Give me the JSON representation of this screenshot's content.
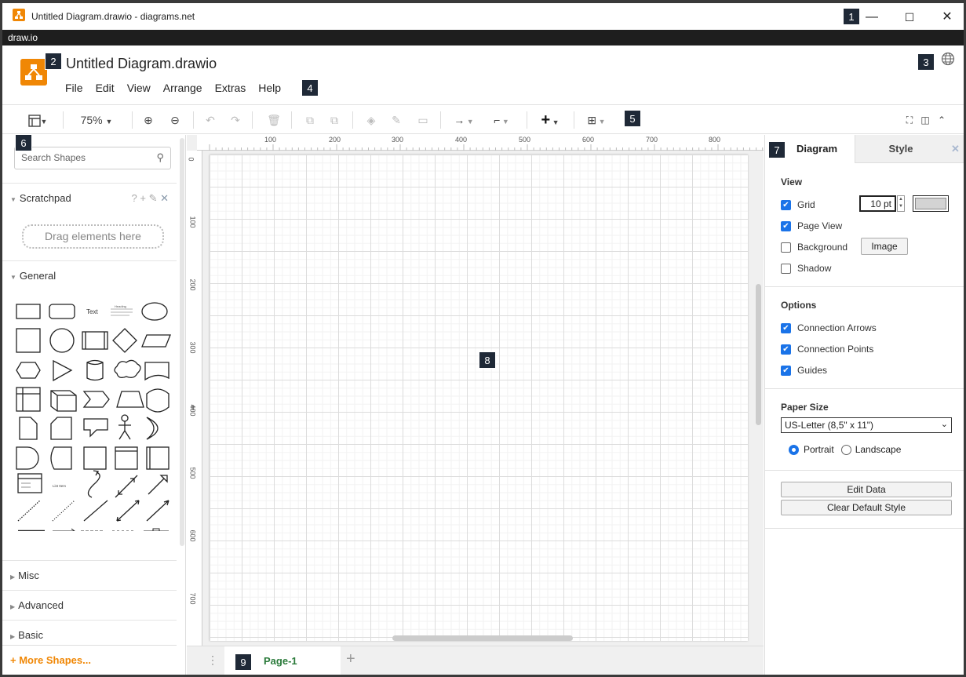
{
  "window": {
    "title": "Untitled Diagram.drawio - diagrams.net",
    "minimize": "—",
    "maximize": "☐",
    "close": "✕",
    "app_bar": "draw.io"
  },
  "header": {
    "doc_title": "Untitled Diagram.drawio",
    "menu": [
      "File",
      "Edit",
      "View",
      "Arrange",
      "Extras",
      "Help"
    ]
  },
  "toolbar": {
    "zoom": "75%"
  },
  "annotations": [
    "1",
    "2",
    "3",
    "4",
    "5",
    "6",
    "7",
    "8",
    "9"
  ],
  "left_panel": {
    "search_placeholder": "Search Shapes",
    "scratchpad": {
      "label": "Scratchpad",
      "drag_hint": "Drag elements here"
    },
    "general": "General",
    "shape_labels": {
      "text": "Text",
      "heading": "Heading",
      "list_item": "List Item"
    },
    "sections": [
      "Misc",
      "Advanced",
      "Basic"
    ],
    "more_shapes": "+ More Shapes..."
  },
  "rulers": {
    "top": [
      "100",
      "200",
      "300",
      "400",
      "500",
      "600",
      "700",
      "800"
    ],
    "left": [
      "0",
      "100",
      "200",
      "300",
      "400",
      "500",
      "600",
      "700"
    ]
  },
  "right_panel": {
    "tabs": {
      "diagram": "Diagram",
      "style": "Style"
    },
    "view": {
      "heading": "View",
      "grid": "Grid",
      "grid_size": "10 pt",
      "page_view": "Page View",
      "background": "Background",
      "image_button": "Image",
      "shadow": "Shadow"
    },
    "options": {
      "heading": "Options",
      "connection_arrows": "Connection Arrows",
      "connection_points": "Connection Points",
      "guides": "Guides"
    },
    "paper": {
      "heading": "Paper Size",
      "size": "US-Letter (8,5\" x 11\")",
      "portrait": "Portrait",
      "landscape": "Landscape"
    },
    "buttons": {
      "edit_data": "Edit Data",
      "clear_style": "Clear Default Style"
    }
  },
  "page_tabs": {
    "page1": "Page-1"
  },
  "colors": {
    "accent": "#f08705",
    "checkbox": "#1a73e8",
    "page_tab": "#2a7a3a"
  }
}
